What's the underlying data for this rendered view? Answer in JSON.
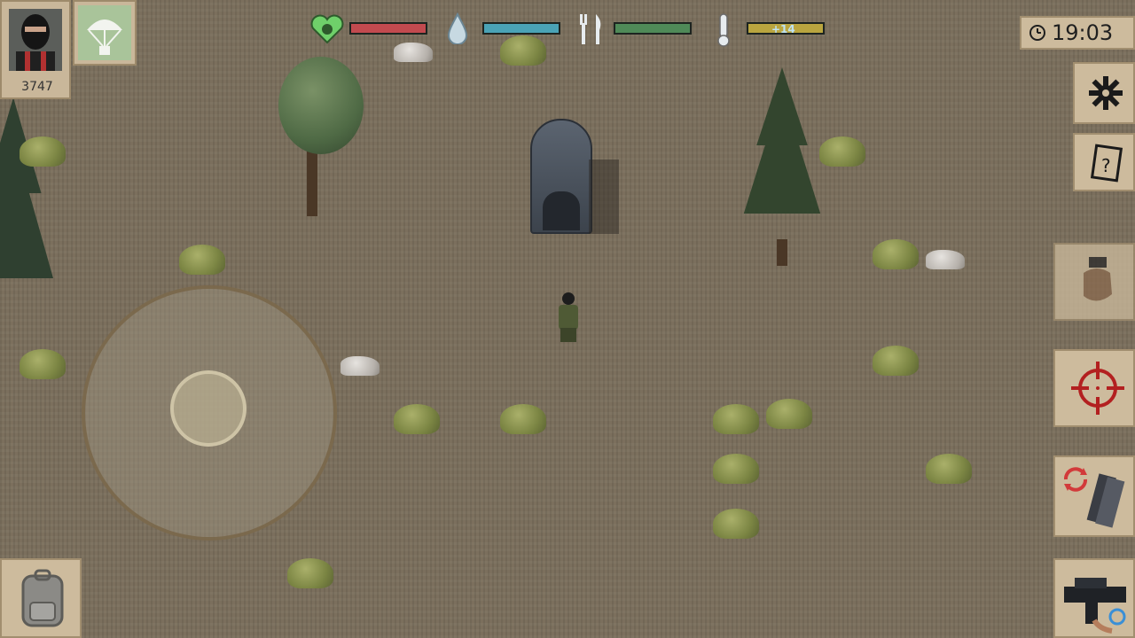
{
  "hud": {
    "score": "3747",
    "clock": "19:03",
    "temperature_label": "+14",
    "bars": {
      "health": 1.0,
      "water": 1.0,
      "food": 1.0,
      "temperature": 1.0
    }
  },
  "colors": {
    "health": "#c24a4f",
    "water": "#4aa3b6",
    "food": "#4f8a58",
    "temperature": "#b9a53f",
    "panel": "#cdbb9d"
  },
  "icons": {
    "avatar": "masked-survivor-icon",
    "airdrop": "parachute-icon",
    "health": "heart-icon",
    "water": "water-drop-icon",
    "food": "fork-knife-icon",
    "temperature": "thermometer-icon",
    "settings": "gear-icon",
    "quests": "notepad-icon",
    "interact": "hand-icon",
    "aim": "crosshair-icon",
    "reload": "reload-icon",
    "weapon": "weapon-icon",
    "inventory": "backpack-icon",
    "clock": "clock-icon"
  }
}
